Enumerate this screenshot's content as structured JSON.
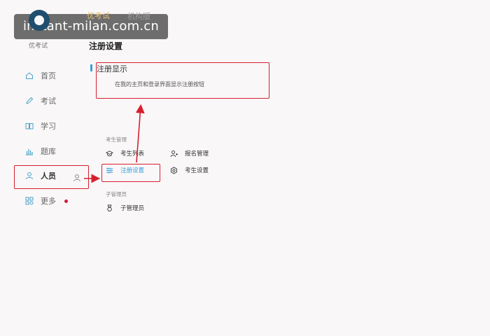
{
  "watermark": {
    "text": "instant-milan.com.cn"
  },
  "app": {
    "name": "优考试"
  },
  "org": {
    "mark": "优考试",
    "name": "机构版"
  },
  "sidebar": {
    "items": [
      {
        "label": "首页",
        "icon": "home-icon"
      },
      {
        "label": "考试",
        "icon": "pencil-icon"
      },
      {
        "label": "学习",
        "icon": "book-icon"
      },
      {
        "label": "题库",
        "icon": "bar-chart-icon"
      },
      {
        "label": "人员",
        "icon": "user-icon"
      },
      {
        "label": "更多",
        "icon": "grid-icon"
      }
    ]
  },
  "page": {
    "title": "注册设置"
  },
  "register_display": {
    "title": "注册显示",
    "desc": "在我的主页和登录界面显示注册按钮"
  },
  "candidate_mgmt": {
    "label": "考生管理",
    "links": {
      "list": "考生列表",
      "signup": "报名管理",
      "register_settings": "注册设置",
      "candidate_settings": "考生设置"
    }
  },
  "sub_admin": {
    "label": "子管理员",
    "links": {
      "sub_admin": "子管理员"
    }
  },
  "colors": {
    "accent": "#3aa0d8",
    "annotation": "#d6202e",
    "logo": "#1f4e6e",
    "notify_dot": "#cc1f3a"
  }
}
